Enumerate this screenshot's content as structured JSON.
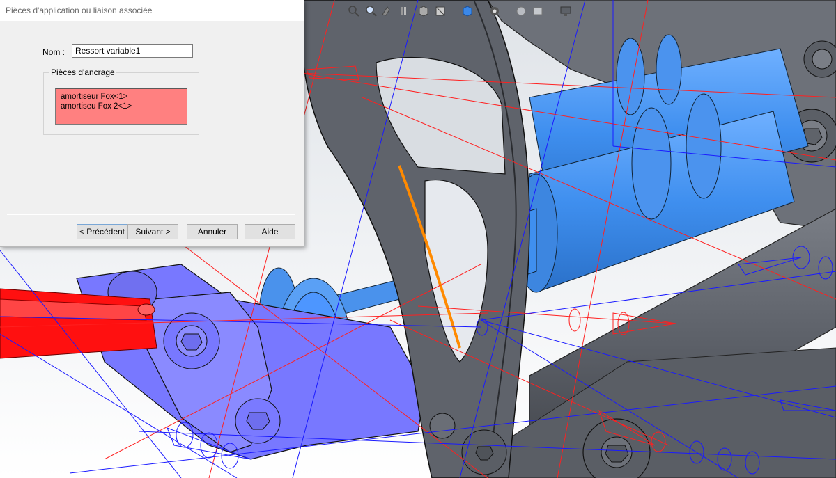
{
  "dialog": {
    "title": "Pièces d'application ou liaison associée",
    "name_label": "Nom :",
    "name_value": "Ressort variable1",
    "anchor_group_label": "Pièces d'ancrage",
    "anchor_items": [
      "amortiseur Fox<1>",
      "amortiseu Fox 2<1>"
    ],
    "buttons": {
      "previous": "< Précédent",
      "next": "Suivant >",
      "cancel": "Annuler",
      "help": "Aide"
    }
  },
  "toolbar": {
    "icons": [
      "zoom-to-fit-icon",
      "zoom-area-icon",
      "previous-view-icon",
      "section-view-icon",
      "view-orientation-icon",
      "display-style-icon",
      "hide-show-icon",
      "edit-appearance-icon",
      "apply-scene-icon",
      "view-settings-icon",
      "monitor-icon"
    ]
  },
  "colors": {
    "listbox_bg": "#ff8080",
    "part_blue": "#4d96ff",
    "part_purple": "#7878ff",
    "part_red": "#ff1010",
    "part_gray": "#6b6f78",
    "force_red": "#ff2020",
    "force_blue": "#1a1aff",
    "highlight_orange": "#ff8a00"
  }
}
